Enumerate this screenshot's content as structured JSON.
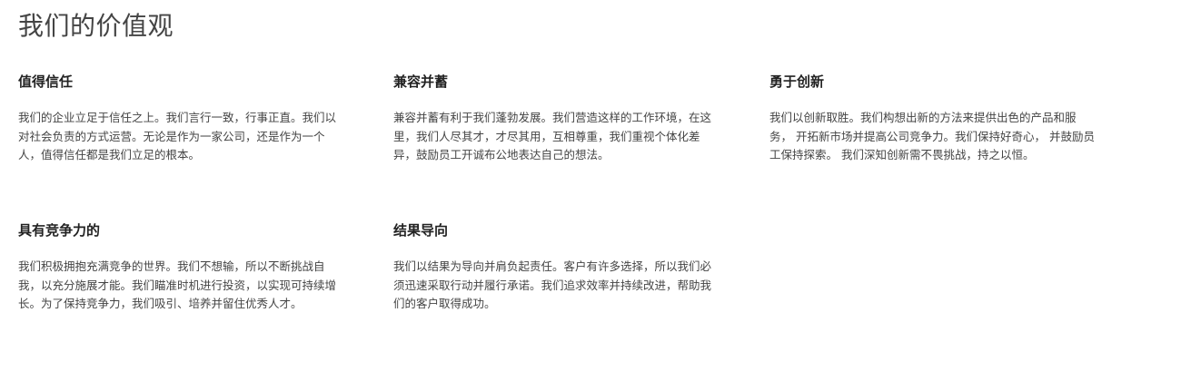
{
  "page": {
    "title": "我们的价值观"
  },
  "values": [
    {
      "title": "值得信任",
      "description": "我们的企业立足于信任之上。我们言行一致，行事正直。我们以对社会负责的方式运营。无论是作为一家公司，还是作为一个人，值得信任都是我们立足的根本。"
    },
    {
      "title": "兼容并蓄",
      "description": "兼容并蓄有利于我们蓬勃发展。我们营造这样的工作环境，在这里，我们人尽其才，才尽其用，互相尊重，我们重视个体化差异，鼓励员工开诚布公地表达自己的想法。"
    },
    {
      "title": "勇于创新",
      "description": "我们以创新取胜。我们构想出新的方法来提供出色的产品和服务， 开拓新市场并提高公司竞争力。我们保持好奇心， 并鼓励员工保持探索。 我们深知创新需不畏挑战，持之以恒。"
    },
    {
      "title": "具有竞争力的",
      "description": "我们积极拥抱充满竞争的世界。我们不想输，所以不断挑战自我，以充分施展才能。我们瞄准时机进行投资，以实现可持续增长。为了保持竞争力，我们吸引、培养并留住优秀人才。"
    },
    {
      "title": "结果导向",
      "description": "我们以结果为导向并肩负起责任。客户有许多选择，所以我们必须迅速采取行动并履行承诺。我们追求效率并持续改进，帮助我们的客户取得成功。"
    }
  ]
}
